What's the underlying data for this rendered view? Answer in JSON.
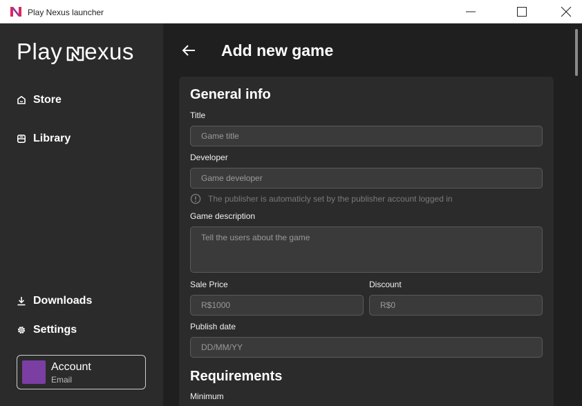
{
  "window": {
    "title": "Play Nexus launcher"
  },
  "sidebar": {
    "logo_text": "Play",
    "logo_text_2": "exus",
    "items": [
      {
        "label": "Store",
        "icon": "store-icon"
      },
      {
        "label": "Library",
        "icon": "library-icon"
      },
      {
        "label": "Downloads",
        "icon": "download-icon"
      },
      {
        "label": "Settings",
        "icon": "gear-icon"
      }
    ],
    "account": {
      "name": "Account",
      "email": "Email",
      "avatar_color": "#7b3ea3"
    }
  },
  "main": {
    "title": "Add new game",
    "general_info": {
      "heading": "General info",
      "title_label": "Title",
      "title_placeholder": "Game title",
      "developer_label": "Developer",
      "developer_placeholder": "Game developer",
      "publisher_note": "The publisher is automaticly set by the publisher account logged in",
      "description_label": "Game description",
      "description_placeholder": "Tell the users about the game",
      "sale_price_label": "Sale Price",
      "sale_price_placeholder": "R$1000",
      "discount_label": "Discount",
      "discount_placeholder": "R$0",
      "publish_date_label": "Publish date",
      "publish_date_placeholder": "DD/MM/YY"
    },
    "requirements": {
      "heading": "Requirements",
      "minimum_label": "Minimum"
    }
  },
  "colors": {
    "sidebar_bg": "#2b2b2b",
    "main_bg": "#1f1f1f",
    "card_bg": "#2b2b2b",
    "input_bg": "#3a3a3a",
    "logo_mark_pink": "#e0245e",
    "logo_mark_purple": "#7b3ea3"
  }
}
